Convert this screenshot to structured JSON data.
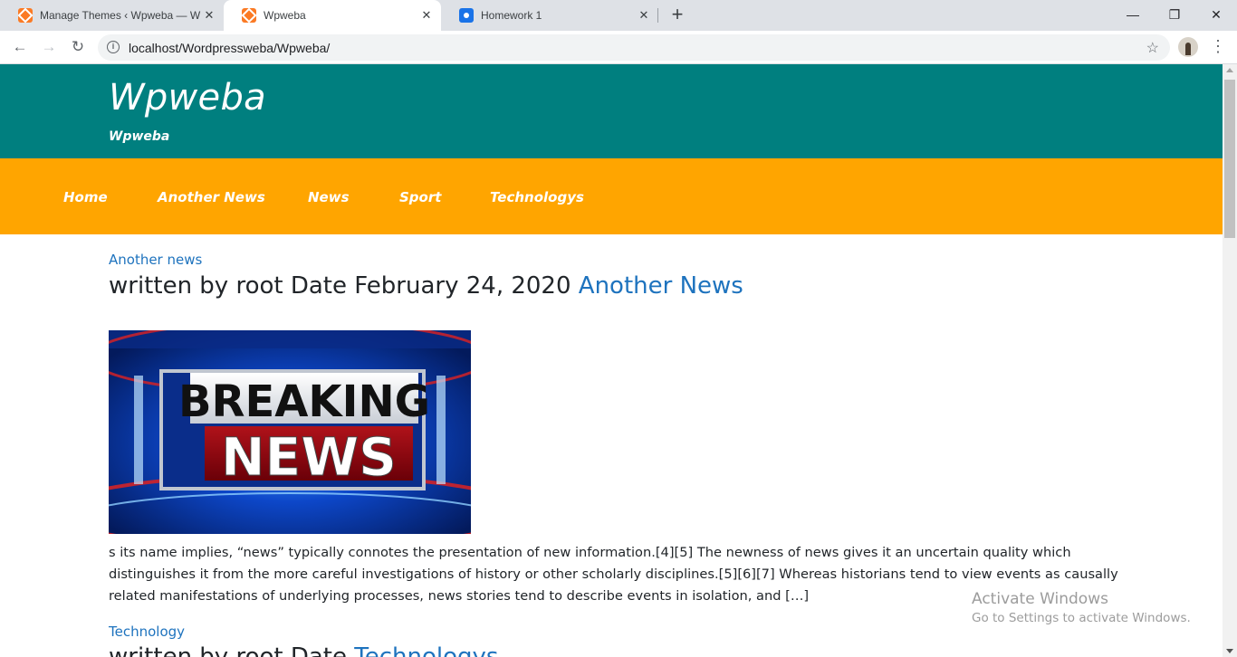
{
  "browser": {
    "tabs": [
      {
        "title": "Manage Themes ‹ Wpweba — W",
        "favicon": "xampp-icon",
        "active": false
      },
      {
        "title": "Wpweba",
        "favicon": "xampp-icon",
        "active": true
      },
      {
        "title": "Homework 1",
        "favicon": "classroom-icon",
        "active": false
      }
    ],
    "url": "localhost/Wordpressweba/Wpweba/"
  },
  "site": {
    "title": "Wpweba",
    "description": "Wpweba",
    "header_color": "#007f7f",
    "nav_color": "#ffa500",
    "link_color": "#1e73be"
  },
  "nav": {
    "items": [
      "Home",
      "Another News",
      "News",
      "Sport",
      "Technologys"
    ]
  },
  "posts": [
    {
      "category": "Another news",
      "meta": "written by root Date February 24, 2020",
      "title_link": "Another News",
      "image_text_top": "BREAKING",
      "image_text_bottom": "NEWS",
      "excerpt": "s its name implies, “news” typically connotes the presentation of new information.[4][5] The newness of news gives it an uncertain quality which distinguishes it from the more careful investigations of history or other scholarly disciplines.[5][6][7] Whereas historians tend to view events as causally related manifestations of underlying processes, news stories tend to describe events in isolation, and […]"
    },
    {
      "category": "Technology",
      "meta": "written by root Date",
      "title_link": "Technologys"
    }
  ],
  "watermark": {
    "line1": "Activate Windows",
    "line2": "Go to Settings to activate Windows."
  }
}
